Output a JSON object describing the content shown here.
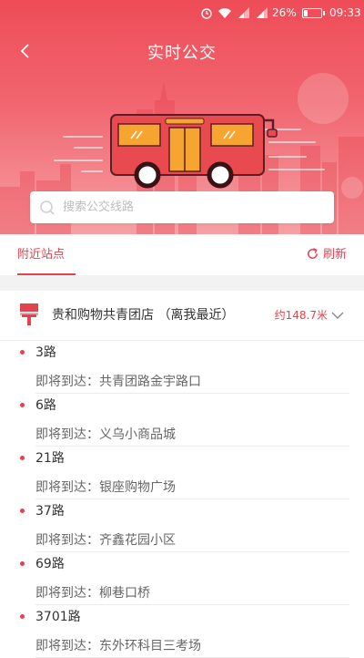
{
  "status_bar": {
    "battery_percent": "26%",
    "battery_level": 0.26,
    "time": "09:33",
    "icons": [
      "alarm-icon",
      "wifi-icon",
      "signal-icon",
      "signal-icon",
      "battery-icon"
    ]
  },
  "header": {
    "title": "实时公交",
    "back_icon": "chevron-left-icon"
  },
  "search": {
    "placeholder": "搜索公交线路",
    "value": ""
  },
  "tabs": {
    "nearby_label": "附近站点",
    "refresh_label": "刷新"
  },
  "station": {
    "name": "贵和购物共青团店 （离我最近）",
    "distance": "约148.7米"
  },
  "routes": [
    {
      "number": "3路",
      "label": "即将到达：",
      "destination": "共青团路金宇路口"
    },
    {
      "number": "6路",
      "label": "即将到达：",
      "destination": "义乌小商品城"
    },
    {
      "number": "21路",
      "label": "即将到达：",
      "destination": "银座购物广场"
    },
    {
      "number": "37路",
      "label": "即将到达：",
      "destination": "齐鑫花园小区"
    },
    {
      "number": "69路",
      "label": "即将到达：",
      "destination": "柳巷口桥"
    },
    {
      "number": "3701路",
      "label": "即将到达：",
      "destination": "东外环科目三考场"
    }
  ],
  "colors": {
    "accent": "#e2434f",
    "header_top": "#ee4c57",
    "bus_body": "#e84a4f",
    "bus_window": "#f7a531"
  }
}
